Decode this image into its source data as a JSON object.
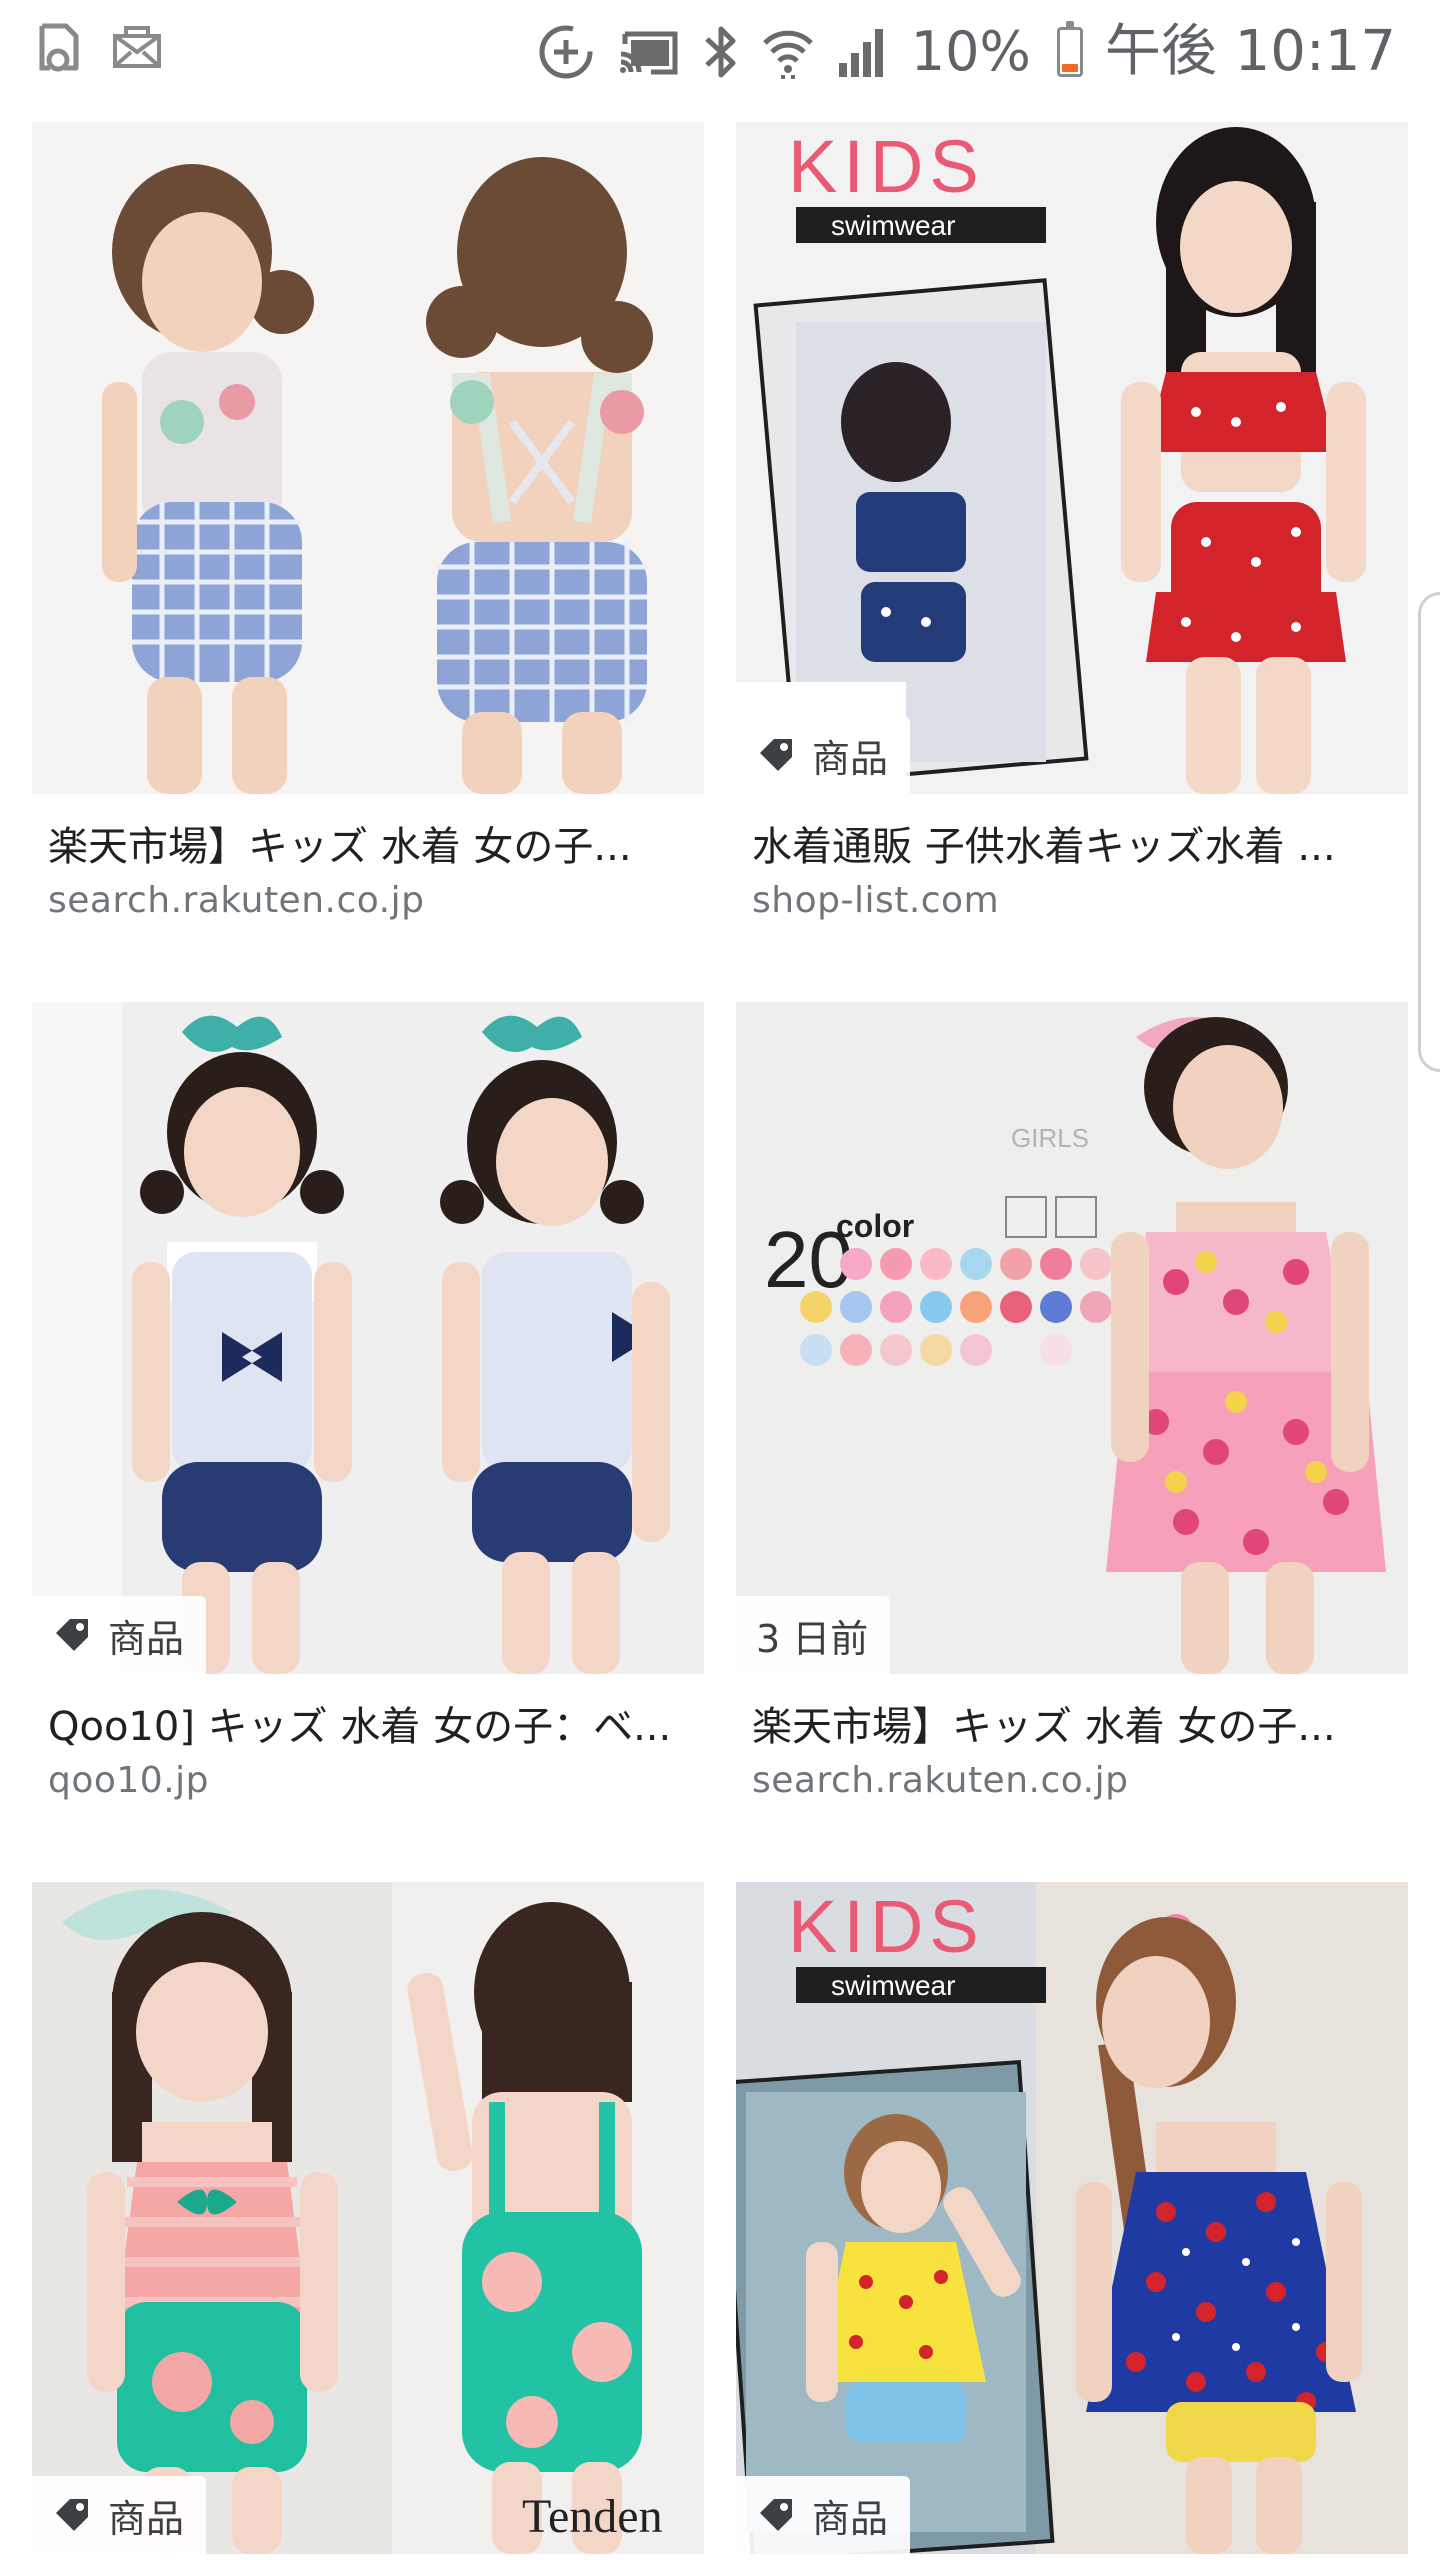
{
  "status_bar": {
    "left_icons": [
      "notification-doc-icon",
      "mail-icon"
    ],
    "right_icons": [
      "data-saver-icon",
      "cast-icon",
      "bluetooth-icon",
      "wifi-icon",
      "cellular-signal-icon",
      "battery-icon"
    ],
    "battery_percent": "10%",
    "battery_level": 0.1,
    "time": "午後 10:17",
    "battery_color": "#f26b21"
  },
  "results": [
    {
      "title": "楽天市場】キッズ 水着 女の子...",
      "source": "search.rakuten.co.jp",
      "badge": "",
      "image_alt": "girl-swimsuit-blue-gingham-front-back"
    },
    {
      "title": "水着通販 子供水着キッズ水着 ...",
      "source": "shop-list.com",
      "badge": "商品",
      "image_text_1": "KIDS",
      "image_text_2": "swimwear",
      "image_alt": "girl-red-heart-bikini"
    },
    {
      "title": "Qoo10] キッズ 水着 女の子：ベ...",
      "source": "qoo10.jp",
      "badge": "商品",
      "image_alt": "twins-sailor-swimsuit"
    },
    {
      "title": "楽天市場】キッズ 水着 女の子...",
      "source": "search.rakuten.co.jp",
      "badge": "3 日前",
      "image_text_1": "20",
      "image_text_2": "color",
      "image_text_3": "GIRLS",
      "image_alt": "girl-heart-tankini-20-colors"
    },
    {
      "title": "",
      "source": "",
      "badge": "商品",
      "image_text_1": "Tenden",
      "image_alt": "girl-teal-ruffle-swimsuit"
    },
    {
      "title": "",
      "source": "",
      "badge": "商品",
      "image_text_1": "KIDS",
      "image_text_2": "swimwear",
      "image_alt": "girls-cherry-tankini"
    }
  ]
}
